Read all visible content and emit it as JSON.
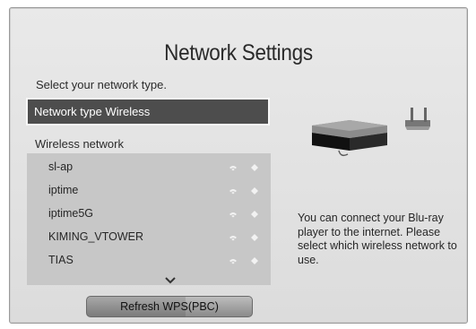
{
  "window": {
    "title": "Network Settings"
  },
  "subtitle": "Select your network type.",
  "network_type": {
    "label": "Network type Wireless"
  },
  "wireless": {
    "label": "Wireless network",
    "networks": [
      {
        "name": "sl-ap"
      },
      {
        "name": "iptime"
      },
      {
        "name": "iptime5G"
      },
      {
        "name": "KIMING_VTOWER"
      },
      {
        "name": "TIAS"
      }
    ]
  },
  "buttons": {
    "refresh": "Refresh WPS(PBC)"
  },
  "help_text": "You can connect your Blu-ray player to the internet. Please select which wireless network to use.",
  "icons": {
    "signal": "wifi-signal-icon",
    "lock": "lock-icon",
    "scroll_down": "chevron-down-icon",
    "player": "blu-ray-player-icon",
    "router": "router-icon"
  }
}
